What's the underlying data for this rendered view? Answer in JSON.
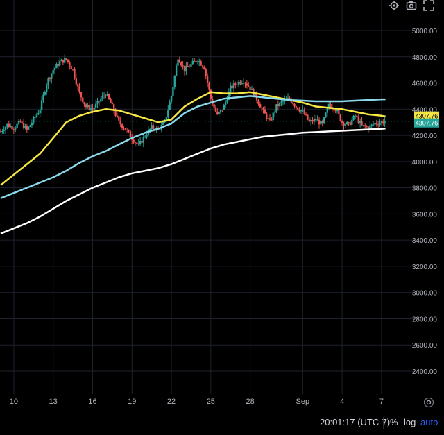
{
  "toolbar": {
    "icons": [
      "gear-icon",
      "camera-icon",
      "expand-icon"
    ]
  },
  "bottom_bar": {
    "time": "20:01:17 (UTC-7)",
    "percent_label": "%",
    "log_label": "log",
    "auto_label": "auto"
  },
  "price_badges": {
    "upper": "4307.76",
    "lower": "4307.76"
  },
  "colors": {
    "background": "#000000",
    "grid": "#1e222d",
    "up": "#26a69a",
    "down": "#ef5350",
    "ma_fast": "#f5e642",
    "ma_mid": "#8ad9ec",
    "ma_slow": "#ffffff",
    "badge_yellow": "#f5e642",
    "badge_teal": "#26a69a"
  },
  "chart_data": {
    "type": "line",
    "title": "",
    "xlabel": "",
    "ylabel": "",
    "ylim": [
      2300,
      5000
    ],
    "y_ticks": [
      2400,
      2600,
      2800,
      3000,
      3200,
      3400,
      3600,
      3800,
      4000,
      4200,
      4400,
      4600,
      4800,
      5000
    ],
    "x_range": [
      9,
      8.15
    ],
    "x_ticks": [
      {
        "label": "10",
        "x": 10
      },
      {
        "label": "13",
        "x": 13
      },
      {
        "label": "16",
        "x": 16
      },
      {
        "label": "19",
        "x": 19
      },
      {
        "label": "22",
        "x": 22
      },
      {
        "label": "25",
        "x": 25
      },
      {
        "label": "28",
        "x": 28
      },
      {
        "label": "Sep",
        "x": 32
      },
      {
        "label": "4",
        "x": 35
      },
      {
        "label": "7",
        "x": 38
      }
    ],
    "x_unit": "day (Aug 9 = 9, Sep 1 = 32)",
    "price_path": [
      [
        9.0,
        4230
      ],
      [
        9.5,
        4280
      ],
      [
        10.0,
        4260
      ],
      [
        10.5,
        4300
      ],
      [
        11.0,
        4240
      ],
      [
        11.5,
        4320
      ],
      [
        12.0,
        4400
      ],
      [
        12.5,
        4600
      ],
      [
        13.0,
        4700
      ],
      [
        13.5,
        4760
      ],
      [
        14.0,
        4780
      ],
      [
        14.5,
        4700
      ],
      [
        15.0,
        4520
      ],
      [
        15.5,
        4420
      ],
      [
        16.0,
        4400
      ],
      [
        16.5,
        4460
      ],
      [
        17.0,
        4520
      ],
      [
        17.5,
        4420
      ],
      [
        18.0,
        4300
      ],
      [
        18.5,
        4250
      ],
      [
        19.0,
        4180
      ],
      [
        19.5,
        4120
      ],
      [
        20.0,
        4200
      ],
      [
        20.5,
        4260
      ],
      [
        21.0,
        4240
      ],
      [
        21.5,
        4300
      ],
      [
        22.0,
        4500
      ],
      [
        22.5,
        4800
      ],
      [
        23.0,
        4700
      ],
      [
        23.5,
        4740
      ],
      [
        24.0,
        4780
      ],
      [
        24.5,
        4720
      ],
      [
        25.0,
        4480
      ],
      [
        25.5,
        4350
      ],
      [
        26.0,
        4420
      ],
      [
        26.5,
        4560
      ],
      [
        27.0,
        4600
      ],
      [
        27.5,
        4620
      ],
      [
        28.0,
        4560
      ],
      [
        28.5,
        4480
      ],
      [
        29.0,
        4380
      ],
      [
        29.5,
        4300
      ],
      [
        30.0,
        4420
      ],
      [
        30.5,
        4460
      ],
      [
        31.0,
        4480
      ],
      [
        31.5,
        4420
      ],
      [
        32.0,
        4380
      ],
      [
        32.5,
        4300
      ],
      [
        33.0,
        4320
      ],
      [
        33.5,
        4280
      ],
      [
        34.0,
        4440
      ],
      [
        34.5,
        4400
      ],
      [
        35.0,
        4300
      ],
      [
        35.5,
        4280
      ],
      [
        36.0,
        4350
      ],
      [
        36.5,
        4270
      ],
      [
        37.0,
        4260
      ],
      [
        37.5,
        4290
      ],
      [
        38.0,
        4300
      ],
      [
        38.3,
        4307.76
      ]
    ],
    "series": [
      {
        "color": "#f5e642",
        "points": [
          [
            9.0,
            3820
          ],
          [
            10.0,
            3900
          ],
          [
            11.0,
            3980
          ],
          [
            12.0,
            4060
          ],
          [
            13.0,
            4180
          ],
          [
            14.0,
            4300
          ],
          [
            15.0,
            4350
          ],
          [
            16.0,
            4380
          ],
          [
            17.0,
            4400
          ],
          [
            18.0,
            4390
          ],
          [
            19.0,
            4360
          ],
          [
            20.0,
            4330
          ],
          [
            21.0,
            4300
          ],
          [
            22.0,
            4320
          ],
          [
            23.0,
            4420
          ],
          [
            24.0,
            4480
          ],
          [
            25.0,
            4530
          ],
          [
            26.0,
            4520
          ],
          [
            27.0,
            4520
          ],
          [
            28.0,
            4530
          ],
          [
            29.0,
            4510
          ],
          [
            30.0,
            4490
          ],
          [
            31.0,
            4470
          ],
          [
            32.0,
            4450
          ],
          [
            33.0,
            4420
          ],
          [
            34.0,
            4410
          ],
          [
            35.0,
            4400
          ],
          [
            36.0,
            4380
          ],
          [
            37.0,
            4360
          ],
          [
            38.0,
            4350
          ],
          [
            38.3,
            4345
          ]
        ]
      },
      {
        "color": "#8ad9ec",
        "points": [
          [
            9.0,
            3720
          ],
          [
            10.0,
            3760
          ],
          [
            11.0,
            3800
          ],
          [
            12.0,
            3840
          ],
          [
            13.0,
            3880
          ],
          [
            14.0,
            3930
          ],
          [
            15.0,
            3990
          ],
          [
            16.0,
            4040
          ],
          [
            17.0,
            4080
          ],
          [
            18.0,
            4130
          ],
          [
            19.0,
            4180
          ],
          [
            20.0,
            4220
          ],
          [
            21.0,
            4250
          ],
          [
            22.0,
            4290
          ],
          [
            23.0,
            4370
          ],
          [
            24.0,
            4420
          ],
          [
            25.0,
            4450
          ],
          [
            26.0,
            4480
          ],
          [
            27.0,
            4490
          ],
          [
            28.0,
            4500
          ],
          [
            29.0,
            4490
          ],
          [
            30.0,
            4480
          ],
          [
            31.0,
            4470
          ],
          [
            32.0,
            4465
          ],
          [
            33.0,
            4460
          ],
          [
            34.0,
            4460
          ],
          [
            35.0,
            4460
          ],
          [
            36.0,
            4465
          ],
          [
            37.0,
            4470
          ],
          [
            38.0,
            4475
          ],
          [
            38.3,
            4475
          ]
        ]
      },
      {
        "color": "#ffffff",
        "points": [
          [
            9.0,
            3450
          ],
          [
            10.0,
            3490
          ],
          [
            11.0,
            3530
          ],
          [
            12.0,
            3580
          ],
          [
            13.0,
            3640
          ],
          [
            14.0,
            3700
          ],
          [
            15.0,
            3750
          ],
          [
            16.0,
            3800
          ],
          [
            17.0,
            3840
          ],
          [
            18.0,
            3880
          ],
          [
            19.0,
            3910
          ],
          [
            20.0,
            3930
          ],
          [
            21.0,
            3950
          ],
          [
            22.0,
            3980
          ],
          [
            23.0,
            4020
          ],
          [
            24.0,
            4060
          ],
          [
            25.0,
            4100
          ],
          [
            26.0,
            4130
          ],
          [
            27.0,
            4150
          ],
          [
            28.0,
            4170
          ],
          [
            29.0,
            4190
          ],
          [
            30.0,
            4200
          ],
          [
            31.0,
            4210
          ],
          [
            32.0,
            4220
          ],
          [
            33.0,
            4225
          ],
          [
            34.0,
            4230
          ],
          [
            35.0,
            4235
          ],
          [
            36.0,
            4240
          ],
          [
            37.0,
            4245
          ],
          [
            38.0,
            4250
          ],
          [
            38.3,
            4252
          ]
        ]
      }
    ],
    "last_price": 4307.76,
    "grid": true
  }
}
